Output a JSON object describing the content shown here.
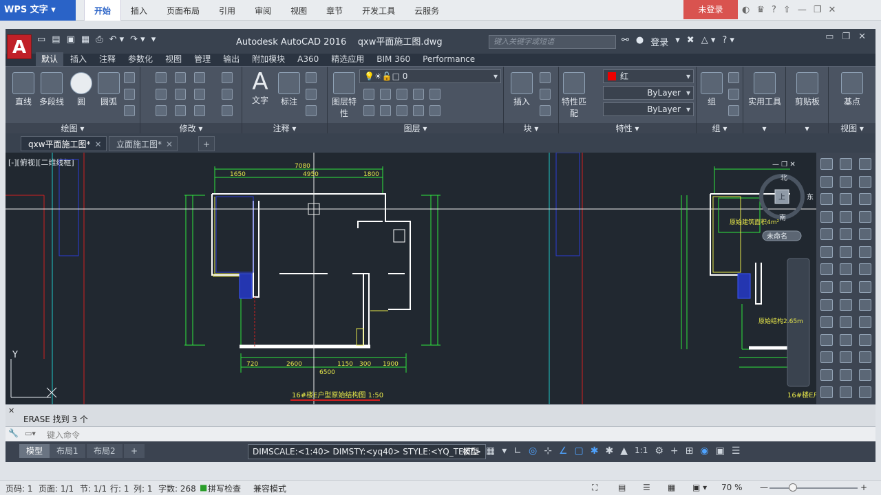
{
  "wps": {
    "app_name": "WPS 文字",
    "tabs": [
      "开始",
      "插入",
      "页面布局",
      "引用",
      "审阅",
      "视图",
      "章节",
      "开发工具",
      "云服务"
    ],
    "login_label": "未登录",
    "help_glyph": "?"
  },
  "cad": {
    "app_letter": "A",
    "title": "Autodesk AutoCAD 2016",
    "file": "qxw平面施工图.dwg",
    "search_placeholder": "键入关键字或短语",
    "login": "登录",
    "ribbon_tabs": [
      "默认",
      "插入",
      "注释",
      "参数化",
      "视图",
      "管理",
      "输出",
      "附加模块",
      "A360",
      "精选应用",
      "BIM 360",
      "Performance"
    ],
    "panels": {
      "draw": {
        "title": "绘图",
        "tools": [
          "直线",
          "多段线",
          "圆",
          "圆弧"
        ]
      },
      "modify": {
        "title": "修改"
      },
      "annotation": {
        "title": "注释",
        "tools": [
          "文字",
          "标注"
        ]
      },
      "layers": {
        "title": "图层",
        "tool": "图层特性",
        "layer_value": "0"
      },
      "block": {
        "title": "块",
        "tool": "插入"
      },
      "properties": {
        "title": "特性",
        "tool": "特性匹配",
        "color_value": "红",
        "linetype_value": "ByLayer",
        "lineweight_value": "ByLayer"
      },
      "group": {
        "title": "组",
        "tool": "组"
      },
      "utilities": {
        "tool": "实用工具"
      },
      "clipboard": {
        "tool": "剪贴板"
      },
      "view": {
        "title": "视图",
        "tool": "基点"
      }
    },
    "doc_tabs": [
      "qxw平面施工图*",
      "立面施工图*"
    ],
    "viewport_label": "[-][俯视][二维线框]",
    "ucs_y": "Y",
    "viewcube": {
      "north": "北",
      "south": "南",
      "east": "东",
      "top": "上",
      "wcs": "未命名"
    },
    "drawing": {
      "title_left": "16#楼E户型原始结构图  1:50",
      "title_right": "16#楼E户",
      "dims_top": [
        "7080",
        "1650",
        "4950",
        "1800"
      ],
      "dims_bottom": [
        "720",
        "2600",
        "1150",
        "300",
        "1900",
        "6500"
      ],
      "right_labels": [
        "原始建筑面积4m²",
        "原始结构2.65m"
      ]
    },
    "command_history": "ERASE 找到 3 个",
    "command_placeholder": "键入命令",
    "layout_tabs": [
      "模型",
      "布局1",
      "布局2"
    ],
    "status_text": "DIMSCALE:<1:40> DIMSTY:<yq40> STYLE:<YQ_TEXT>",
    "status_model": "模型",
    "scale": "1:1"
  },
  "wps_status": {
    "page": "页码: 1",
    "pages": "页面: 1/1",
    "section": "节: 1/1",
    "row": "行: 1",
    "col": "列: 1",
    "words": "字数: 268",
    "spell": "拼写检查",
    "compat": "兼容模式",
    "zoom": "70 %"
  },
  "colors": {
    "accent": "#2a63c7",
    "login_red": "#d9534f",
    "cad_bg": "#212830",
    "green": "#2ee83e",
    "yellow": "#e8e84a"
  }
}
